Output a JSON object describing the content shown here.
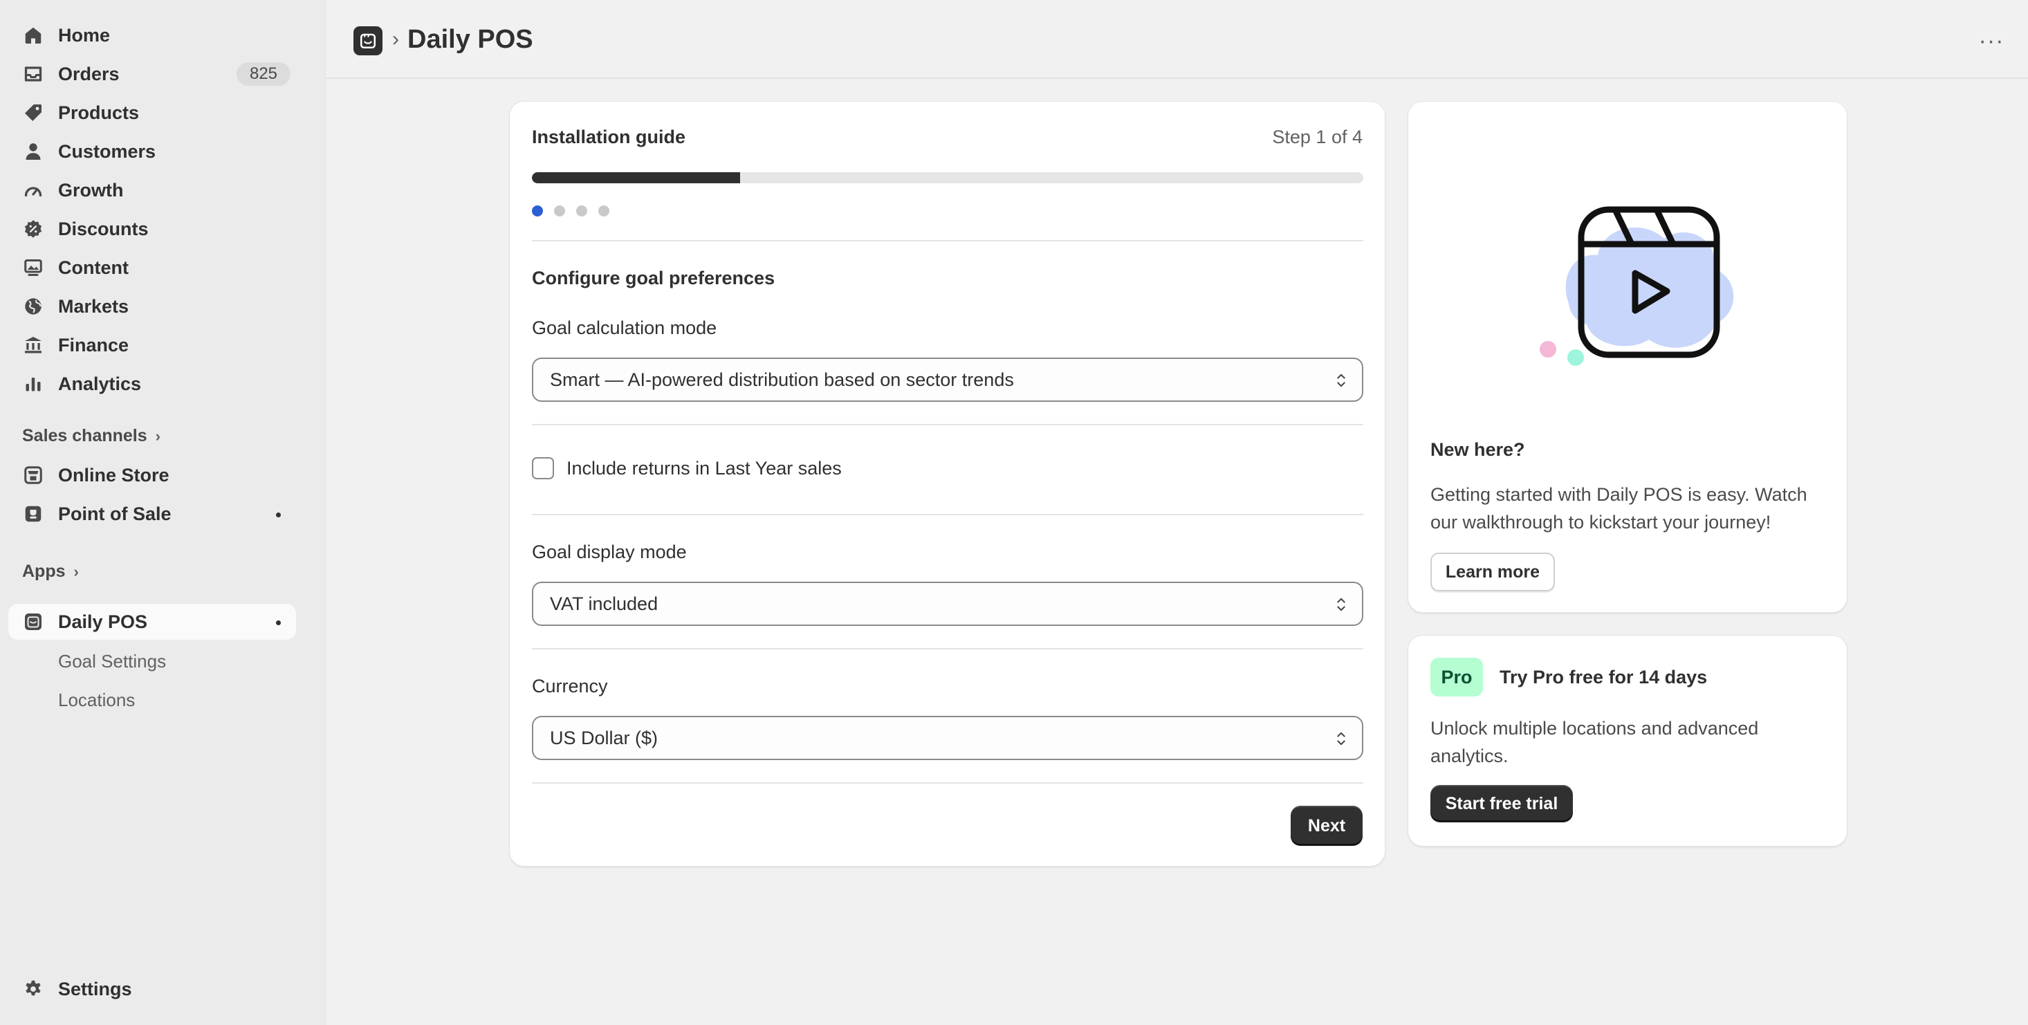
{
  "sidebar": {
    "nav": [
      {
        "label": "Home",
        "icon": "home-icon"
      },
      {
        "label": "Orders",
        "icon": "inbox-icon",
        "badge": "825"
      },
      {
        "label": "Products",
        "icon": "tag-icon"
      },
      {
        "label": "Customers",
        "icon": "person-icon"
      },
      {
        "label": "Growth",
        "icon": "gauge-icon"
      },
      {
        "label": "Discounts",
        "icon": "discount-icon"
      },
      {
        "label": "Content",
        "icon": "content-icon"
      },
      {
        "label": "Markets",
        "icon": "globe-icon"
      },
      {
        "label": "Finance",
        "icon": "bank-icon"
      },
      {
        "label": "Analytics",
        "icon": "bar-chart-icon"
      }
    ],
    "sales_channels_label": "Sales channels",
    "channels": [
      {
        "label": "Online Store",
        "icon": "store-icon"
      },
      {
        "label": "Point of Sale",
        "icon": "pos-icon"
      }
    ],
    "apps_label": "Apps",
    "app": {
      "label": "Daily POS",
      "icon": "daily-pos-icon"
    },
    "app_subitems": [
      "Goal Settings",
      "Locations"
    ],
    "settings_label": "Settings"
  },
  "header": {
    "title": "Daily POS"
  },
  "guide": {
    "title": "Installation guide",
    "step_text": "Step 1 of 4",
    "progress": 0.25,
    "section_title": "Configure goal preferences",
    "calc_mode_label": "Goal calculation mode",
    "calc_mode_value": "Smart — AI-powered distribution based on sector trends",
    "returns_label": "Include returns in Last Year sales",
    "returns_checked": false,
    "display_mode_label": "Goal display mode",
    "display_mode_value": "VAT included",
    "currency_label": "Currency",
    "currency_value": "US Dollar ($)",
    "next_label": "Next"
  },
  "promo": {
    "title": "New here?",
    "text": "Getting started with Daily POS is easy. Watch our walkthrough to kickstart your journey!",
    "button_label": "Learn more"
  },
  "pro": {
    "badge": "Pro",
    "title": "Try Pro free for 14 days",
    "text": "Unlock multiple locations and advanced analytics.",
    "button_label": "Start free trial"
  },
  "colors": {
    "accent_dot": "#2c5fd1",
    "pro_badge_bg": "#b4fed2",
    "primary_button": "#303030"
  }
}
